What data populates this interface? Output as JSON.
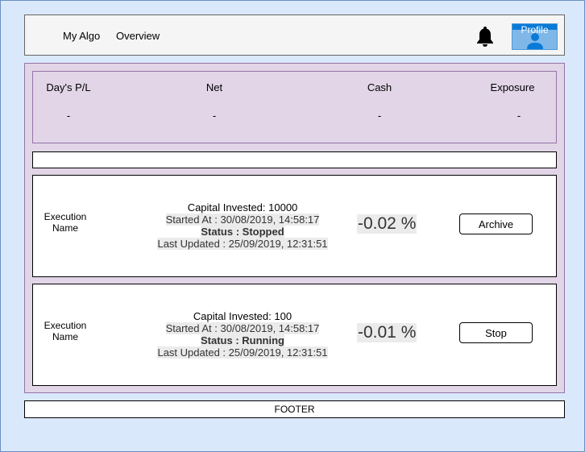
{
  "header": {
    "nav": [
      {
        "label": "My Algo"
      },
      {
        "label": "Overview"
      }
    ],
    "notifications_icon": "bell-icon",
    "profile": {
      "label": "Profile",
      "icon": "user-icon"
    }
  },
  "summary": [
    {
      "title": "Day's P/L",
      "value": "-"
    },
    {
      "title": "Net",
      "value": "-"
    },
    {
      "title": "Cash",
      "value": "-"
    },
    {
      "title": "Exposure",
      "value": "-"
    }
  ],
  "executions": [
    {
      "name": "Execution Name",
      "capital": "Capital Invested: 10000",
      "started": "Started At : 30/08/2019, 14:58:17",
      "status": "Status : Stopped",
      "updated": "Last Updated : 25/09/2019, 12:31:51",
      "pnl": "-0.02 %",
      "action": "Archive"
    },
    {
      "name": "Execution Name",
      "capital": "Capital Invested: 100",
      "started": "Started At : 30/08/2019, 14:58:17",
      "status": "Status : Running",
      "updated": "Last Updated : 25/09/2019, 12:31:51",
      "pnl": "-0.01 %",
      "action": "Stop"
    }
  ],
  "footer": {
    "label": "FOOTER"
  },
  "colors": {
    "background": "#dae8fc",
    "panel": "#e1d5e7",
    "profile": "#7fb8e8"
  }
}
